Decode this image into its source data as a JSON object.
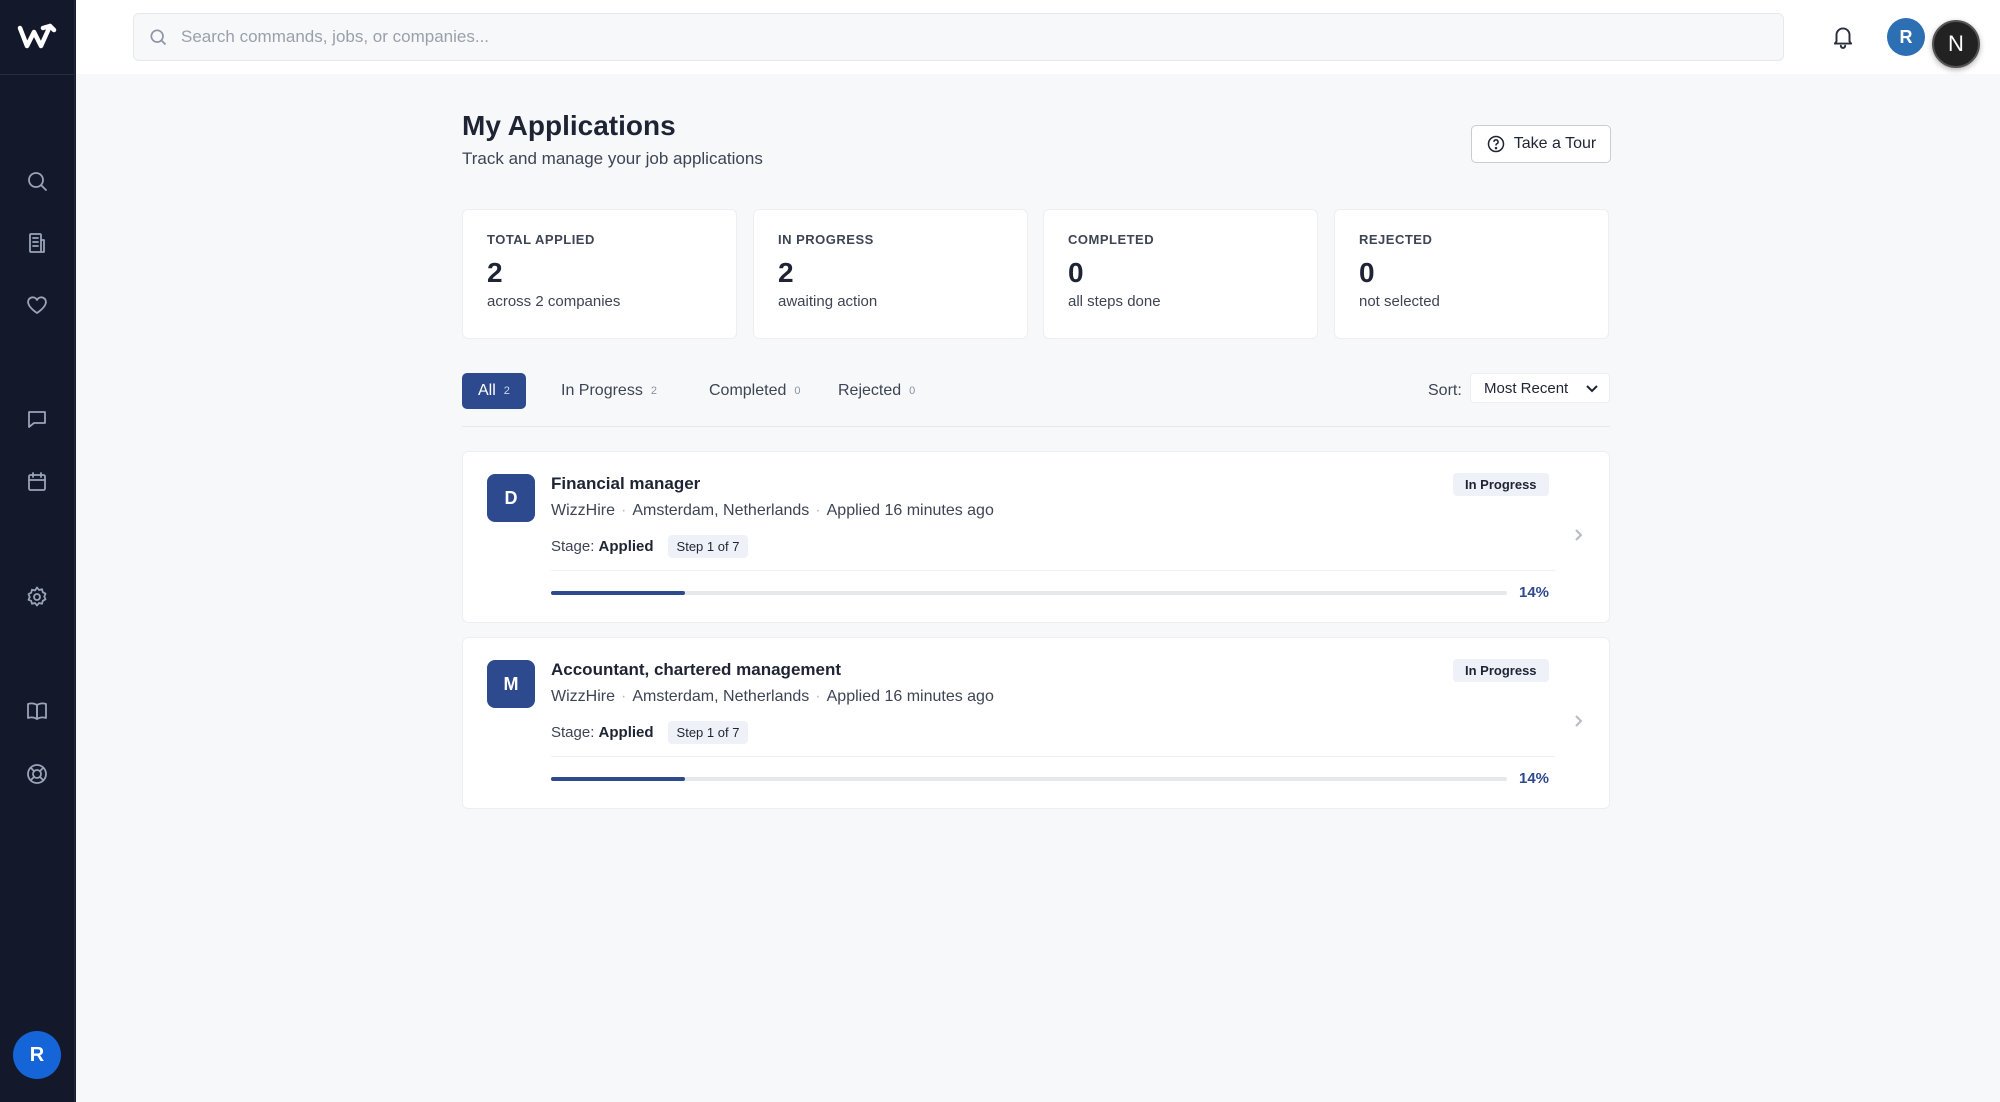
{
  "header": {
    "search_placeholder": "Search commands, jobs, or companies...",
    "user_initial": "R",
    "badge_letter": "N"
  },
  "sidebar": {
    "items": [
      {
        "name": "search-icon"
      },
      {
        "name": "building-icon"
      },
      {
        "name": "heart-icon"
      },
      {
        "name": "chat-icon"
      },
      {
        "name": "calendar-icon"
      },
      {
        "name": "gear-icon"
      },
      {
        "name": "book-icon"
      },
      {
        "name": "lifebuoy-icon"
      }
    ],
    "user_initial": "R"
  },
  "page": {
    "title": "My Applications",
    "subtitle": "Track and manage your job applications",
    "tour_label": "Take a Tour"
  },
  "stats": [
    {
      "label": "TOTAL APPLIED",
      "value": "2",
      "note": "across 2 companies"
    },
    {
      "label": "IN PROGRESS",
      "value": "2",
      "note": "awaiting action"
    },
    {
      "label": "COMPLETED",
      "value": "0",
      "note": "all steps done"
    },
    {
      "label": "REJECTED",
      "value": "0",
      "note": "not selected"
    }
  ],
  "tabs": [
    {
      "label": "All",
      "count": "2",
      "active": true
    },
    {
      "label": "In Progress",
      "count": "2",
      "active": false
    },
    {
      "label": "Completed",
      "count": "0",
      "active": false
    },
    {
      "label": "Rejected",
      "count": "0",
      "active": false
    }
  ],
  "sort": {
    "label": "Sort:",
    "value": "Most Recent"
  },
  "applications": [
    {
      "initial": "D",
      "title": "Financial manager",
      "company": "WizzHire",
      "location": "Amsterdam, Netherlands",
      "applied": "Applied 16 minutes ago",
      "stage_label": "Stage:",
      "stage": "Applied",
      "step": "Step 1 of 7",
      "status": "In Progress",
      "progress": 0.14,
      "progress_text": "14%"
    },
    {
      "initial": "M",
      "title": "Accountant, chartered management",
      "company": "WizzHire",
      "location": "Amsterdam, Netherlands",
      "applied": "Applied 16 minutes ago",
      "stage_label": "Stage:",
      "stage": "Applied",
      "step": "Step 1 of 7",
      "status": "In Progress",
      "progress": 0.14,
      "progress_text": "14%"
    }
  ],
  "colors": {
    "accent": "#2d4a8e",
    "sidebar": "#13182b"
  }
}
